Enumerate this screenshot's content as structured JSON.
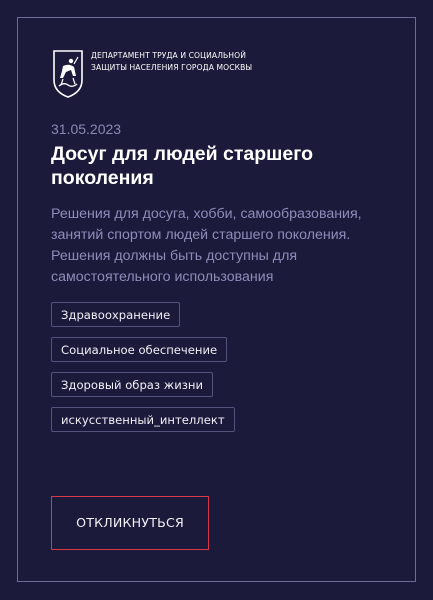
{
  "organization": {
    "name": "ДЕПАРТАМЕНТ ТРУДА И СОЦИАЛЬНОЙ ЗАЩИТЫ НАСЕЛЕНИЯ ГОРОДА МОСКВЫ",
    "logo_icon": "moscow-coat-of-arms-icon"
  },
  "card": {
    "date": "31.05.2023",
    "title": "Досуг для людей старшего поколения",
    "description": "Решения для досуга, хобби, самообразования, занятий спортом людей старшего поколения. Решения должны быть доступны для самостоятельного использования",
    "tags": [
      "Здравоохранение",
      "Социальное обеспечение",
      "Здоровый образ жизни",
      "искусственный_интеллект"
    ],
    "respond_label": "ОТКЛИКНУТЬСЯ"
  },
  "colors": {
    "background": "#1b1a3a",
    "card_border": "#6e6c96",
    "muted_text": "#8f8cba",
    "tag_border": "#55537b",
    "accent_red": "#d9374a"
  }
}
